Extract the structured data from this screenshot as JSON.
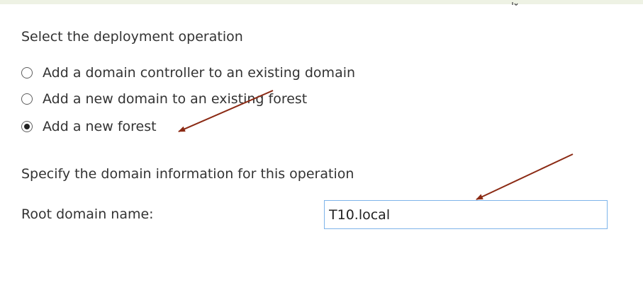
{
  "deployment": {
    "heading": "Select the deployment operation",
    "options": [
      {
        "label": "Add a domain controller to an existing domain",
        "selected": false
      },
      {
        "label": "Add a new domain to an existing forest",
        "selected": false
      },
      {
        "label": "Add a new forest",
        "selected": true
      }
    ]
  },
  "domain_info": {
    "heading": "Specify the domain information for this operation",
    "root_domain_label": "Root domain name:",
    "root_domain_value": "T10.local"
  },
  "colors": {
    "annotation_arrow": "#8b2a14",
    "input_border": "#7eb4ea",
    "top_strip": "#eef2e4"
  }
}
